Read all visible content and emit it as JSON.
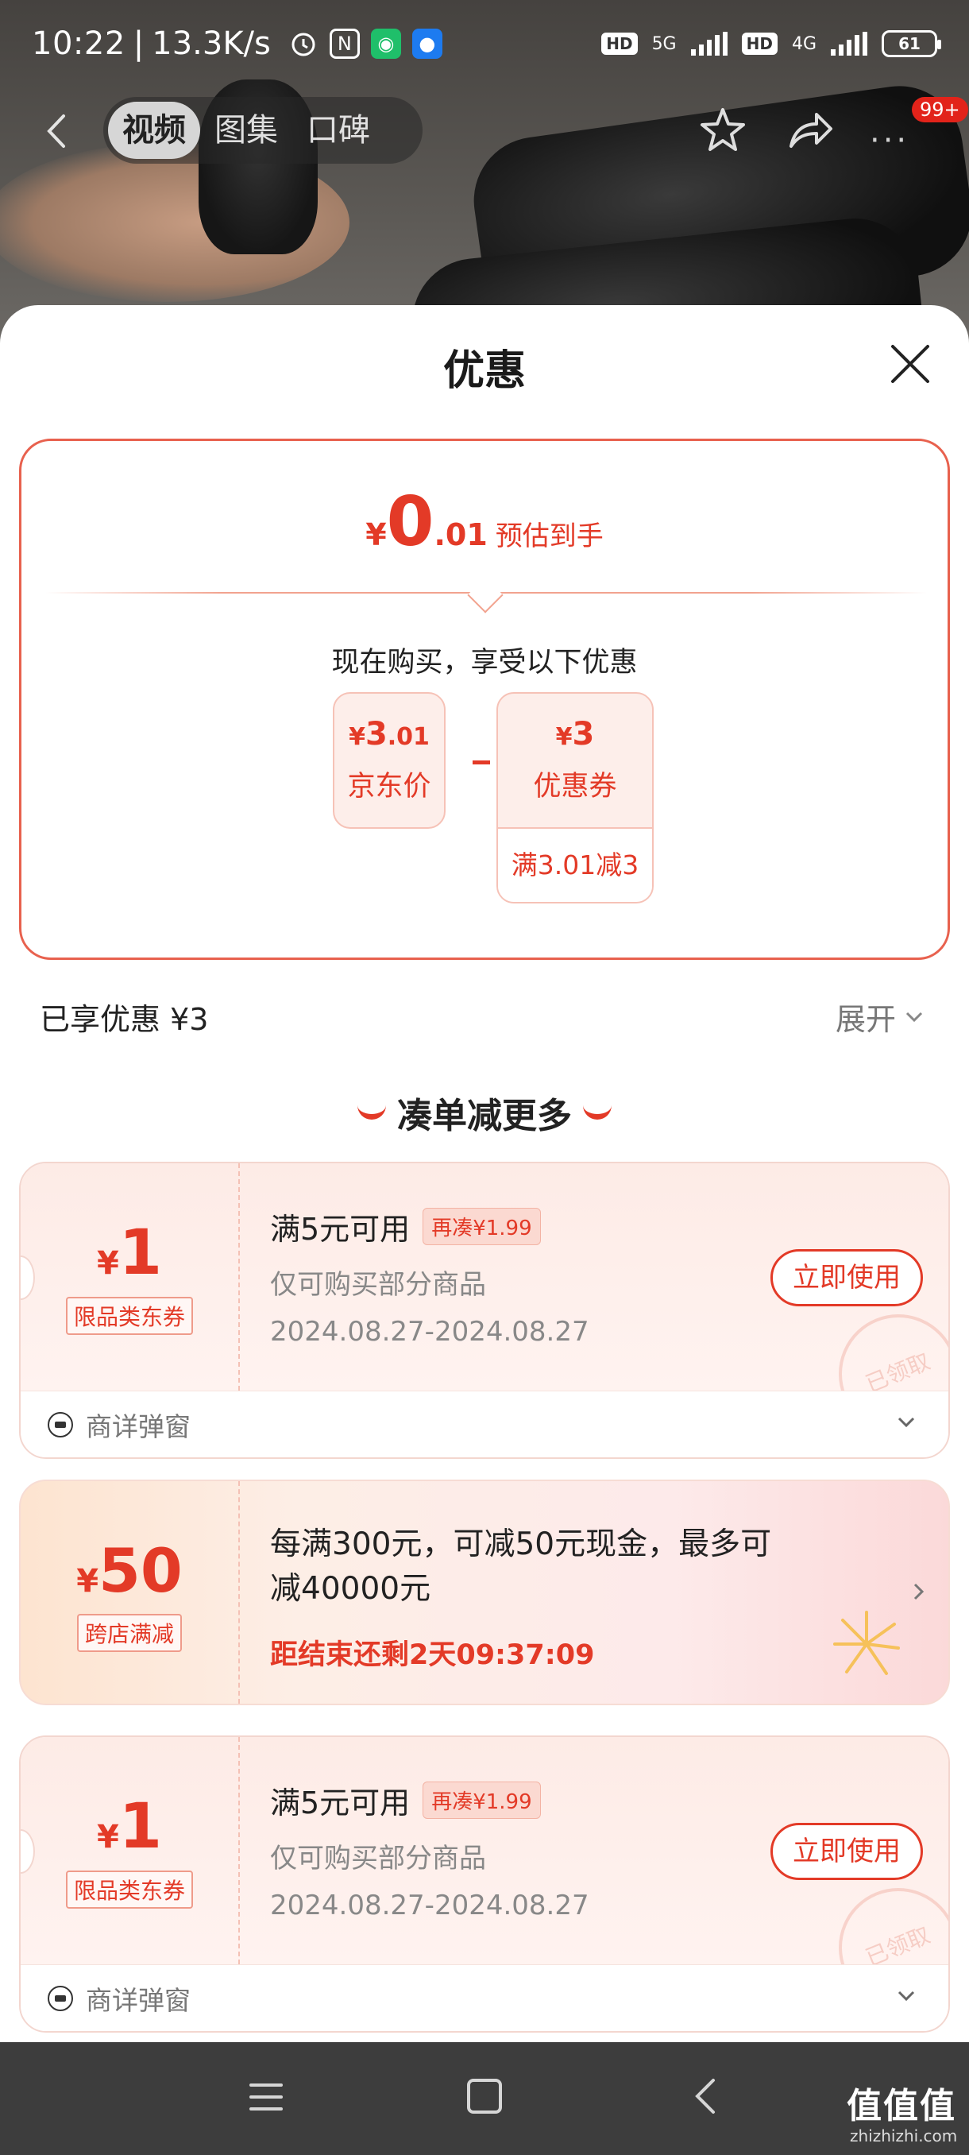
{
  "status_bar": {
    "time": "10:22",
    "net_speed": "13.3K/s",
    "hd1": "HD",
    "net1": "5G",
    "hd2": "HD",
    "net2": "4G",
    "battery": "61"
  },
  "top_nav": {
    "tabs": [
      {
        "label": "视频",
        "active": true
      },
      {
        "label": "图集",
        "active": false
      },
      {
        "label": "口碑",
        "active": false
      }
    ],
    "badge": "99+",
    "more": "···"
  },
  "sheet": {
    "title": "优惠",
    "summary": {
      "currency": "¥",
      "amount_int": "0",
      "amount_dec": ".01",
      "est_label": "预估到手",
      "buy_now": "现在购买，享受以下优惠",
      "price_box": {
        "currency": "¥",
        "int": "3",
        "dec": ".01",
        "caption": "京东价"
      },
      "coupon_box": {
        "currency": "¥",
        "int": "3",
        "caption": "优惠券",
        "condition": "满3.01减3"
      }
    },
    "enjoyed": "已享优惠 ¥3",
    "expand_label": "展开",
    "section_title": "凑单减更多",
    "coupons": [
      {
        "currency": "¥",
        "amount": "1",
        "tag": "限品类东券",
        "condition": "满5元可用",
        "chip": "再凑¥1.99",
        "scope": "仅可购买部分商品",
        "dates": "2024.08.27-2024.08.27",
        "button": "立即使用",
        "stamp": "已领取",
        "footer": "商详弹窗"
      },
      {
        "currency": "¥",
        "amount": "1",
        "tag": "限品类东券",
        "condition": "满5元可用",
        "chip": "再凑¥1.99",
        "scope": "仅可购买部分商品",
        "dates": "2024.08.27-2024.08.27",
        "button": "立即使用",
        "stamp": "已领取",
        "footer": "商详弹窗"
      }
    ],
    "discount": {
      "currency": "¥",
      "amount": "50",
      "tag": "跨店满减",
      "desc": "每满300元，可减50元现金，最多可减40000元",
      "countdown": "距结束还剩2天09:37:09"
    }
  },
  "watermark": {
    "text": "值值值",
    "sub": "zhizhizhi.com"
  },
  "colors": {
    "accent": "#e33a27",
    "sheet_bg": "#ffffff",
    "nav_bar": "#3d3d3d"
  }
}
